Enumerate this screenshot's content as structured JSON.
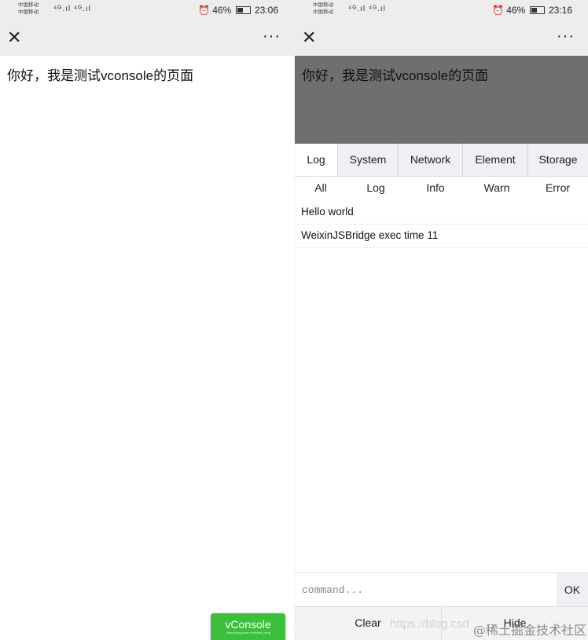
{
  "left": {
    "status": {
      "carrier1": "中国移动",
      "carrier2": "中国移动",
      "signal": "⁴ᴳ.ıl ⁴ᴳ.ıl",
      "alarm": "⏰",
      "battery": "46%",
      "time": "23:06"
    },
    "nav": {
      "close": "✕",
      "more": "···"
    },
    "page_text": "你好，我是测试vconsole的页面",
    "vconsole_button": "vConsole",
    "vconsole_watermark": "https://blog.csdn.net/Miss_liang"
  },
  "right": {
    "status": {
      "carrier1": "中国移动",
      "carrier2": "中国移动",
      "signal": "⁴ᴳ.ıl ⁴ᴳ.ıl",
      "alarm": "⏰",
      "battery": "46%",
      "time": "23:16"
    },
    "nav": {
      "close": "✕",
      "more": "···"
    },
    "page_text": "你好，我是测试vconsole的页面",
    "tabs": [
      "Log",
      "System",
      "Network",
      "Element",
      "Storage"
    ],
    "subtabs": [
      "All",
      "Log",
      "Info",
      "Warn",
      "Error"
    ],
    "logs": [
      "Hello world",
      "WeixinJSBridge exec time 11"
    ],
    "command_placeholder": "command...",
    "ok": "OK",
    "clear": "Clear",
    "hide": "Hide",
    "watermark_url": "https://blog.csd",
    "watermark_cn": "@稀土掘金技术社区"
  },
  "colors": {
    "accent_green": "#3cbf3c",
    "overlay": "#6f6f6f",
    "active_tab_line": "#4a90e2"
  }
}
